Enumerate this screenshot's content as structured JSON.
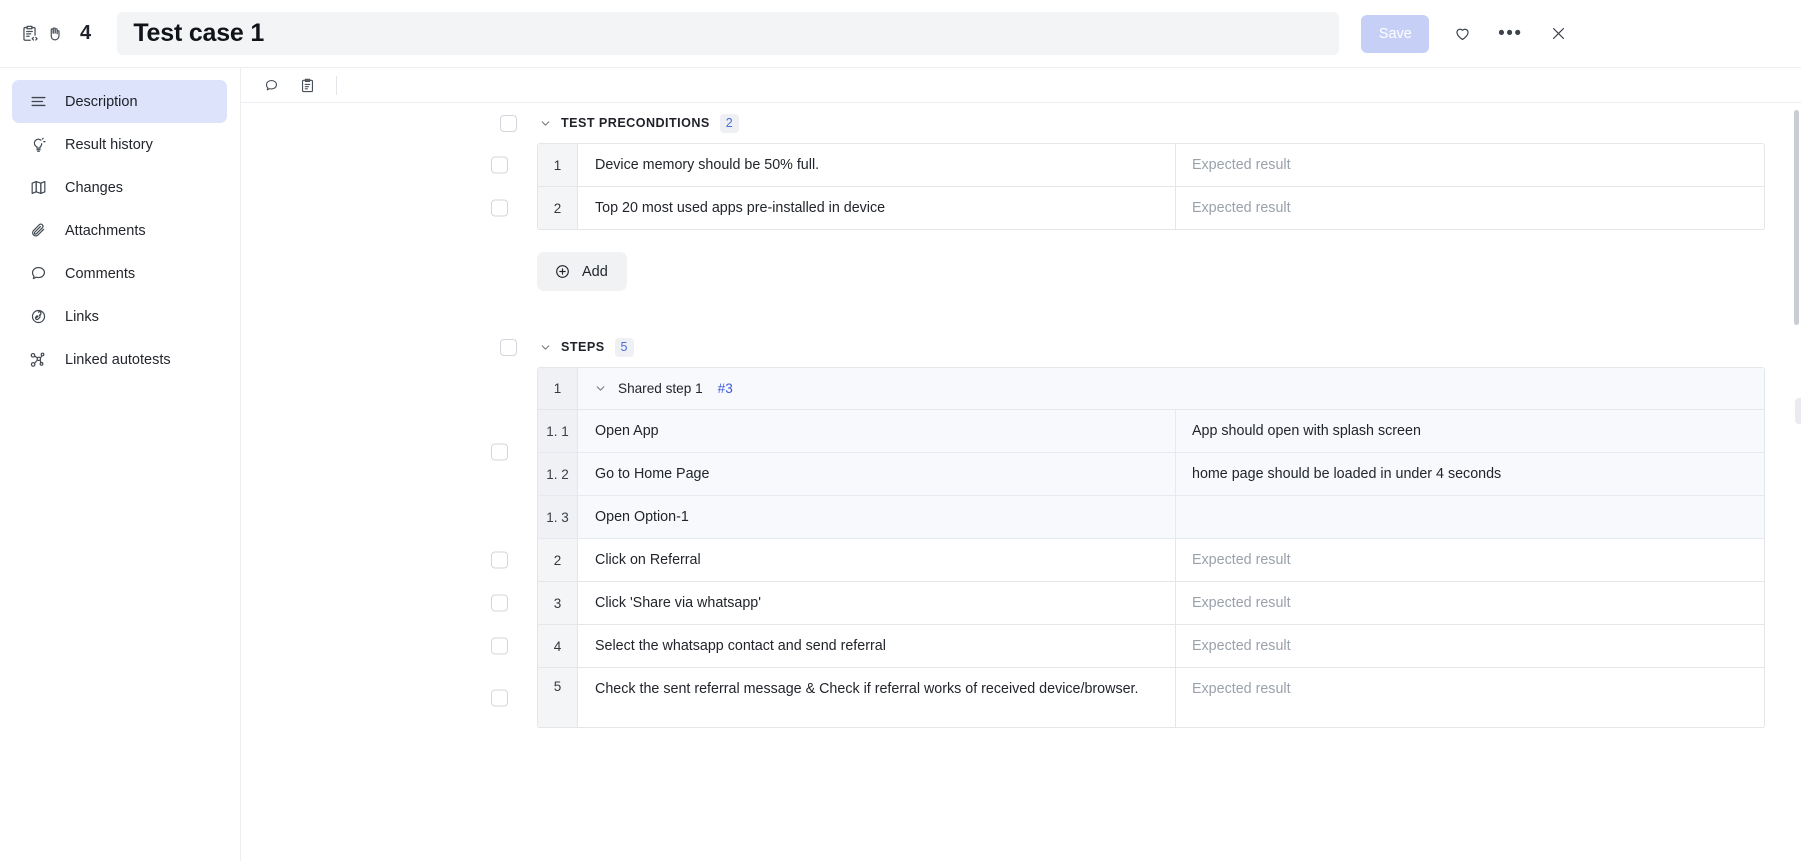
{
  "topbar": {
    "doc_icon": "clipboard-code-icon",
    "hand_icon": "hand-icon",
    "number": "4",
    "title_value": "Test case 1",
    "title_placeholder": "Title",
    "save_label": "Save",
    "favorite_icon": "heart-icon",
    "more_icon": "ellipsis-icon",
    "close_icon": "close-icon"
  },
  "sidebar": {
    "items": [
      {
        "label": "Description",
        "icon": "description-lines-icon",
        "active": true
      },
      {
        "label": "Result history",
        "icon": "bulb-icon",
        "active": false
      },
      {
        "label": "Changes",
        "icon": "map-icon",
        "active": false
      },
      {
        "label": "Attachments",
        "icon": "paperclip-icon",
        "active": false
      },
      {
        "label": "Comments",
        "icon": "comment-bubble-icon",
        "active": false
      },
      {
        "label": "Links",
        "icon": "link-icon",
        "active": false
      },
      {
        "label": "Linked autotests",
        "icon": "node-graph-icon",
        "active": false
      }
    ]
  },
  "main_toolbar": {
    "comment_icon": "comment-bubble-icon",
    "clipboard_icon": "clipboard-icon"
  },
  "preconditions": {
    "title": "TEST PRECONDITIONS",
    "count": "2",
    "expected_placeholder": "Expected result",
    "rows": [
      {
        "num": "1",
        "action": "Device memory should be 50% full.",
        "expected": ""
      },
      {
        "num": "2",
        "action": "Top 20 most used apps pre-installed in device",
        "expected": ""
      }
    ],
    "add_label": "Add"
  },
  "steps": {
    "title": "STEPS",
    "count": "5",
    "expected_placeholder": "Expected result",
    "shared_group": {
      "num": "1",
      "label": "Shared step 1",
      "ref": "#3",
      "substeps": [
        {
          "num": "1. 1",
          "action": "Open App",
          "expected": "App should open with splash screen"
        },
        {
          "num": "1. 2",
          "action": "Go to Home Page",
          "expected": "home page should be loaded in under 4 seconds"
        },
        {
          "num": "1. 3",
          "action": "Open Option-1",
          "expected": ""
        }
      ]
    },
    "rows": [
      {
        "num": "2",
        "action": "Click on Referral",
        "expected": ""
      },
      {
        "num": "3",
        "action": "Click 'Share via whatsapp'",
        "expected": ""
      },
      {
        "num": "4",
        "action": "Select the whatsapp contact and send referral",
        "expected": ""
      },
      {
        "num": "5",
        "action": "Check the sent referral message & Check if referral works of received device/browser.",
        "expected": ""
      }
    ]
  },
  "colors": {
    "accent": "#4d6bdc",
    "save_disabled": "#c6d0f7",
    "sidebar_active": "#dde3fb",
    "shared_row_bg": "#f8f9fd"
  }
}
